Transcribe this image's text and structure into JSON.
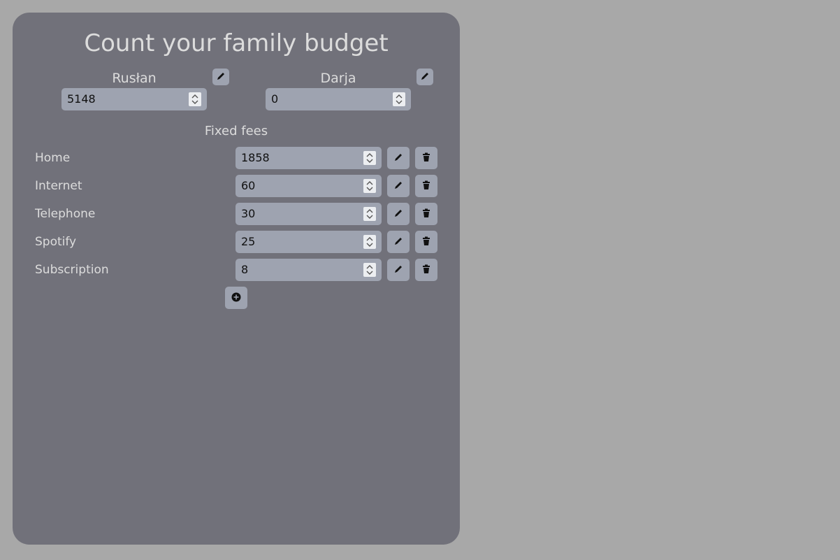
{
  "title": "Count your family budget",
  "persons": [
    {
      "name": "Rusłan",
      "income": "5148"
    },
    {
      "name": "Darja",
      "income": "0"
    }
  ],
  "fixed_fees": {
    "title": "Fixed fees",
    "items": [
      {
        "label": "Home",
        "value": "1858"
      },
      {
        "label": "Internet",
        "value": "60"
      },
      {
        "label": "Telephone",
        "value": "30"
      },
      {
        "label": "Spotify",
        "value": "25"
      },
      {
        "label": "Subscription",
        "value": "8"
      }
    ]
  },
  "icons": {
    "edit": "pencil-icon",
    "delete": "trash-icon",
    "add": "plus-circle-icon",
    "spinner": "up-down-chevron-icon"
  },
  "colors": {
    "background": "#a8a8a8",
    "panel": "#71717a",
    "input": "#9ea3b0",
    "text_light": "#dcdcdc"
  }
}
